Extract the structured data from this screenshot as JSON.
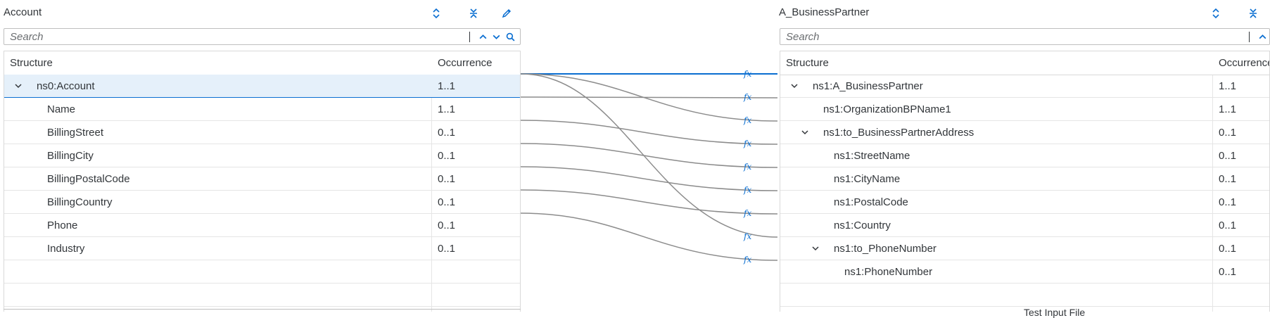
{
  "source": {
    "title": "Account",
    "search_placeholder": "Search",
    "columns": {
      "structure": "Structure",
      "occurrence": "Occurrence"
    },
    "rows": [
      {
        "name": "ns0:Account",
        "occurrence": "1..1",
        "expandable": true,
        "level": 0,
        "selected": true
      },
      {
        "name": "Name",
        "occurrence": "1..1",
        "level": 1
      },
      {
        "name": "BillingStreet",
        "occurrence": "0..1",
        "level": 1
      },
      {
        "name": "BillingCity",
        "occurrence": "0..1",
        "level": 1
      },
      {
        "name": "BillingPostalCode",
        "occurrence": "0..1",
        "level": 1
      },
      {
        "name": "BillingCountry",
        "occurrence": "0..1",
        "level": 1
      },
      {
        "name": "Phone",
        "occurrence": "0..1",
        "level": 1
      },
      {
        "name": "Industry",
        "occurrence": "0..1",
        "level": 1
      }
    ]
  },
  "target": {
    "title": "A_BusinessPartner",
    "search_placeholder": "Search",
    "columns": {
      "structure": "Structure",
      "occurrence": "Occurrence"
    },
    "rows": [
      {
        "name": "ns1:A_BusinessPartner",
        "occurrence": "1..1",
        "expandable": true,
        "level": 0
      },
      {
        "name": "ns1:OrganizationBPName1",
        "occurrence": "1..1",
        "level": 1
      },
      {
        "name": "ns1:to_BusinessPartnerAddress",
        "occurrence": "0..1",
        "expandable": true,
        "level": 1
      },
      {
        "name": "ns1:StreetName",
        "occurrence": "0..1",
        "level": 2
      },
      {
        "name": "ns1:CityName",
        "occurrence": "0..1",
        "level": 2
      },
      {
        "name": "ns1:PostalCode",
        "occurrence": "0..1",
        "level": 2
      },
      {
        "name": "ns1:Country",
        "occurrence": "0..1",
        "level": 2
      },
      {
        "name": "ns1:to_PhoneNumber",
        "occurrence": "0..1",
        "expandable": true,
        "level": 2
      },
      {
        "name": "ns1:PhoneNumber",
        "occurrence": "0..1",
        "level": 3
      }
    ]
  },
  "mapping": {
    "function_label": "fx",
    "connections": [
      {
        "from": 0,
        "to": 0,
        "highlighted": true
      },
      {
        "from": 0,
        "to": 2
      },
      {
        "from": 0,
        "to": 7
      },
      {
        "from": 1,
        "to": 1
      },
      {
        "from": 2,
        "to": 3
      },
      {
        "from": 3,
        "to": 4
      },
      {
        "from": 4,
        "to": 5
      },
      {
        "from": 5,
        "to": 6
      },
      {
        "from": 6,
        "to": 8
      }
    ]
  },
  "footer_text": "Test Input File",
  "colors": {
    "accent": "#0a6ed1",
    "line": "#8c8c8c",
    "selected_row": "#e5f0fa"
  }
}
